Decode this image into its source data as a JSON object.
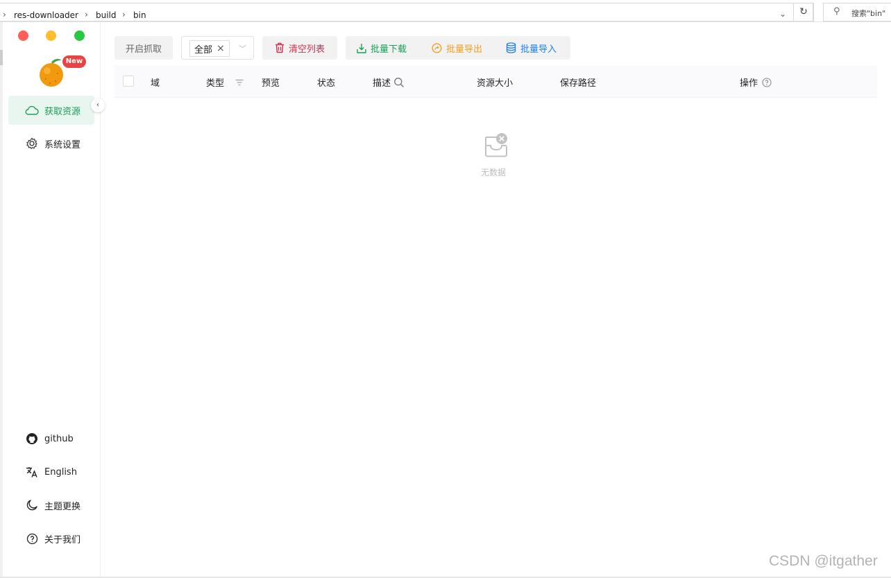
{
  "explorer": {
    "breadcrumbs": [
      "res-downloader",
      "build",
      "bin"
    ],
    "search_placeholder": "搜索\"bin\""
  },
  "window_controls": {
    "close_color": "#ff5f57",
    "minimize_color": "#febc2e",
    "maximize_color": "#28c840"
  },
  "logo": {
    "badge": "New"
  },
  "sidebar": {
    "top_items": [
      {
        "label": "获取资源",
        "icon": "cloud-icon",
        "active": true
      },
      {
        "label": "系统设置",
        "icon": "gear-icon",
        "active": false
      }
    ],
    "bottom_items": [
      {
        "label": "github",
        "icon": "github-icon"
      },
      {
        "label": "English",
        "icon": "translate-icon"
      },
      {
        "label": "主题更换",
        "icon": "moon-icon"
      },
      {
        "label": "关于我们",
        "icon": "help-circle-icon"
      }
    ]
  },
  "toolbar": {
    "start_capture": "开启抓取",
    "filter_tag": "全部",
    "clear_list": "清空列表",
    "batch_download": "批量下载",
    "batch_export": "批量导出",
    "batch_import": "批量导入"
  },
  "table": {
    "columns": [
      "域",
      "类型",
      "预览",
      "状态",
      "描述",
      "资源大小",
      "保存路径",
      "操作"
    ],
    "empty_text": "无数据"
  },
  "colors": {
    "accent_green": "#18a058",
    "danger_red": "#d03050",
    "warning_orange": "#f0a020",
    "info_blue": "#2080f0"
  },
  "watermark": "CSDN @itgather"
}
